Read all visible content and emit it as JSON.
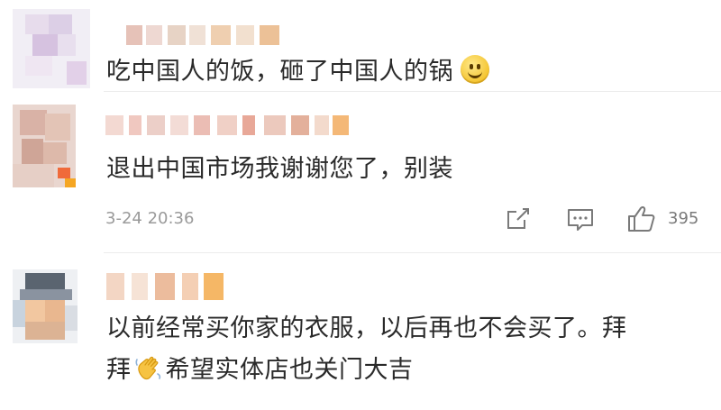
{
  "comments": [
    {
      "text": "吃中国人的饭，砸了中国人的锅",
      "emoji": "smiling-face-emoji"
    },
    {
      "text": "退出中国市场我谢谢您了，别装",
      "time": "3-24 20:36",
      "actions": {
        "share_icon": "share-icon",
        "comment_icon": "comment-icon",
        "like_icon": "thumbs-up-icon",
        "like_count": "395"
      }
    },
    {
      "text_line1": "以前经常买你家的衣服，以后再也不会买了。拜",
      "text_line2a": "拜",
      "emoji": "waving-hand-emoji",
      "text_line2b": "希望实体店也关门大吉"
    }
  ],
  "colors": {
    "text": "#2a2a2a",
    "meta": "#9a9a9a",
    "icon": "#7a7a7a",
    "divider": "#ececec"
  }
}
